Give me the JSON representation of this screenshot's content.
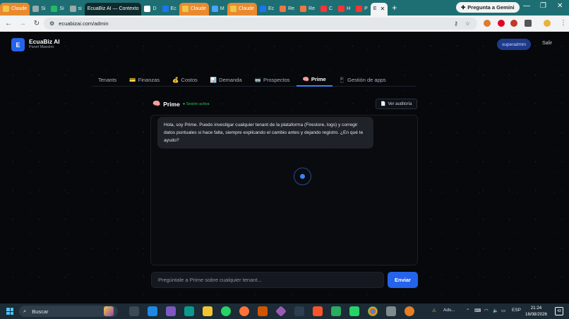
{
  "browser": {
    "tabs": [
      {
        "label": "Claude",
        "style": "orange",
        "icon": "claude-icon",
        "color": "#f0c64a"
      },
      {
        "label": "Si",
        "style": "plain",
        "icon": "globe-icon",
        "color": "#9aa"
      },
      {
        "label": "Si",
        "style": "plain",
        "icon": "sri-icon",
        "color": "#2b6"
      },
      {
        "label": "si",
        "style": "plain",
        "icon": "globe-icon",
        "color": "#9aa"
      },
      {
        "label": "EcuaBiz AI — Contexto",
        "style": "dark",
        "icon": "",
        "color": ""
      },
      {
        "label": "D",
        "style": "plain",
        "icon": "github-icon",
        "color": "#fff"
      },
      {
        "label": "Ec",
        "style": "plain",
        "icon": "facebook-icon",
        "color": "#1877f2"
      },
      {
        "label": "Claude",
        "style": "orange",
        "icon": "claude-icon",
        "color": "#f0c64a"
      },
      {
        "label": "M",
        "style": "plain",
        "icon": "meta-icon",
        "color": "#4aa3ff"
      },
      {
        "label": "Claude",
        "style": "orange",
        "icon": "claude-icon",
        "color": "#f0c64a"
      },
      {
        "label": "Ec",
        "style": "plain",
        "icon": "facebook-icon",
        "color": "#1877f2"
      },
      {
        "label": "Re",
        "style": "plain",
        "icon": "gmail-icon",
        "color": "#e74"
      },
      {
        "label": "Re",
        "style": "plain",
        "icon": "gmail-icon",
        "color": "#e74"
      },
      {
        "label": "C",
        "style": "plain",
        "icon": "youtube-icon",
        "color": "#f33"
      },
      {
        "label": "H",
        "style": "plain",
        "icon": "youtube-icon",
        "color": "#f33"
      },
      {
        "label": "P",
        "style": "plain",
        "icon": "youtube-icon",
        "color": "#f33"
      },
      {
        "label": "E",
        "style": "active",
        "icon": "",
        "color": ""
      }
    ],
    "new_tab": "+",
    "gemini_label": "Pregunta a Gemini",
    "url": "ecuabizai.com/admin"
  },
  "app": {
    "logo_letter": "E",
    "brand": "EcuaBiz AI",
    "brand_sub": "Panel Maestro",
    "role": "superadmin",
    "logout": "Salir",
    "nav": [
      {
        "label": "Tenants",
        "icon": "",
        "active": false
      },
      {
        "label": "Finanzas",
        "icon": "💳",
        "active": false
      },
      {
        "label": "Costos",
        "icon": "💰",
        "active": false
      },
      {
        "label": "Demanda",
        "icon": "📊",
        "active": false
      },
      {
        "label": "Prospectos",
        "icon": "🥽",
        "active": false
      },
      {
        "label": "Prime",
        "icon": "🧠",
        "active": true
      },
      {
        "label": "Gestión de apps",
        "icon": "📱",
        "active": false
      }
    ],
    "chat": {
      "icon": "🧠",
      "title": "Prime",
      "status": "● Sesión activa",
      "audit_label": "Ver auditoría",
      "message": "Hola, soy Prime. Puedo investigar cualquier tenant de la plataforma (Firestore, logs) y corregir datos puntuales si hace falta, siempre explicando el cambio antes y dejando registro. ¿En qué te ayudo?",
      "input_placeholder": "Pregúntale a Prime sobre cualquier tenant...",
      "send_label": "Enviar"
    }
  },
  "taskbar": {
    "search_label": "Buscar",
    "tray_alert": "Adv...",
    "language": "ESP",
    "time": "21:24",
    "date": "16/08/2026",
    "notifications": "43"
  },
  "colors": {
    "accent": "#2563eb",
    "active_status": "#22c55e",
    "browser_frame": "#1e6f73"
  }
}
